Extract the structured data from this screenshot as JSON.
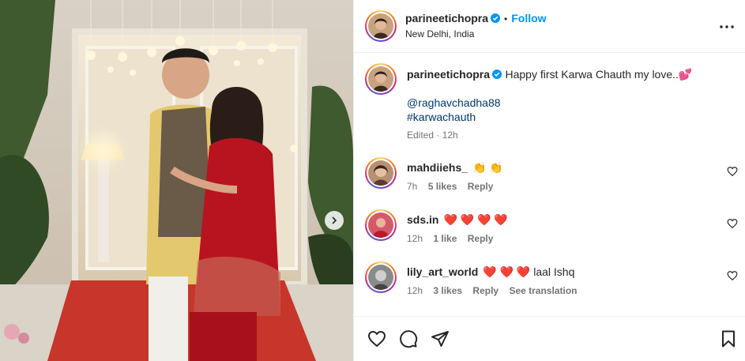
{
  "post": {
    "username": "parineetichopra",
    "follow_label": "Follow",
    "separator": "•",
    "location": "New Delhi, India"
  },
  "caption": {
    "username": "parineetichopra",
    "text": "Happy first Karwa Chauth my love..",
    "emoji": "💕",
    "mention": "@raghavchadha88",
    "hashtag": "#karwachauth",
    "meta": "Edited · 12h"
  },
  "comments": [
    {
      "username": "mahdiiehs_",
      "text": "👏 👏",
      "time": "7h",
      "likes": "5 likes",
      "reply": "Reply"
    },
    {
      "username": "sds.in",
      "text": "❤️ ❤️ ❤️ ❤️",
      "time": "12h",
      "likes": "1 like",
      "reply": "Reply"
    },
    {
      "username": "lily_art_world",
      "text": "❤️ ❤️ ❤️ laal Ishq",
      "time": "12h",
      "likes": "3 likes",
      "reply": "Reply",
      "translate": "See translation"
    }
  ],
  "icons": {
    "verified": "verified-badge-icon",
    "more": "more-options-icon",
    "like": "heart-icon",
    "comment": "comment-icon",
    "share": "share-icon",
    "save": "bookmark-icon",
    "next": "chevron-right-icon"
  },
  "colors": {
    "accent": "#0095f6",
    "link": "#00376b",
    "muted": "#737373",
    "verified": "#0095f6"
  }
}
